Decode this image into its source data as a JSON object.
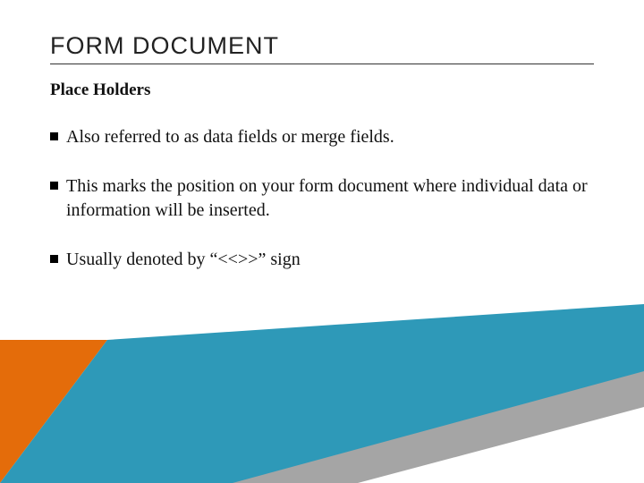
{
  "title": "FORM DOCUMENT",
  "subtitle": "Place Holders",
  "bullets": [
    "Also referred to as data fields or merge fields.",
    "This marks the position on your form document where individual data or information will be inserted.",
    "Usually denoted by “<<>>” sign"
  ],
  "colors": {
    "orange": "#E46C0A",
    "teal": "#2E99B8",
    "gray": "#A5A5A5"
  }
}
